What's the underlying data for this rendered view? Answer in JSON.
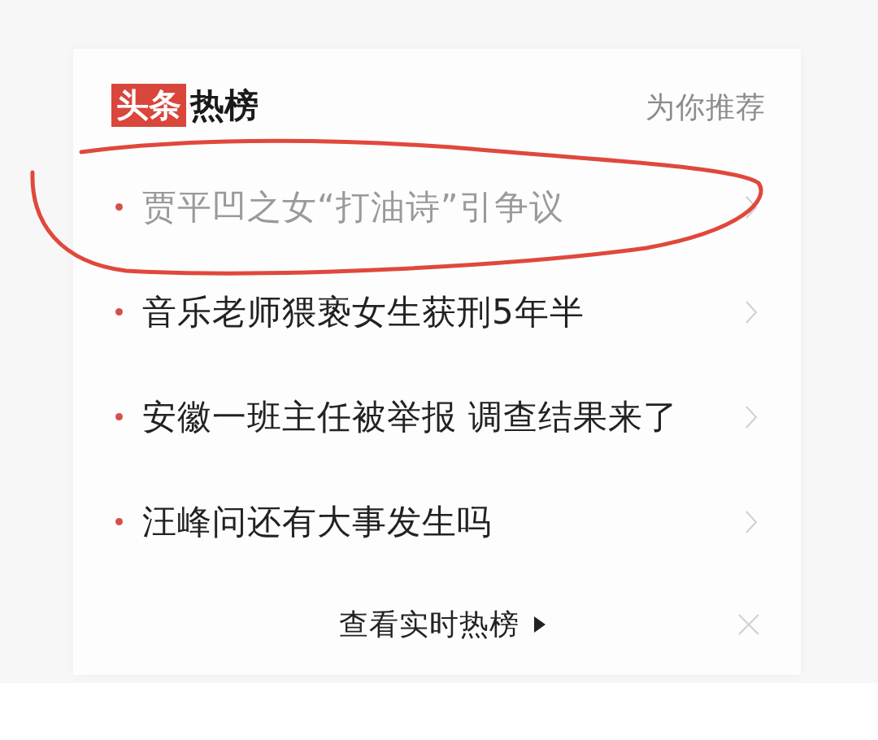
{
  "header": {
    "badge": "头条",
    "title": "热榜",
    "recommend": "为你推荐"
  },
  "items": [
    {
      "title": "贾平凹之女“打油诗”引争议",
      "read": true,
      "circled": true
    },
    {
      "title": "音乐老师猥亵女生获刑5年半",
      "read": false,
      "circled": false
    },
    {
      "title": "安徽一班主任被举报 调查结果来了",
      "read": false,
      "circled": false
    },
    {
      "title": "汪峰问还有大事发生吗",
      "read": false,
      "circled": false
    }
  ],
  "footer": {
    "link": "查看实时热榜"
  }
}
